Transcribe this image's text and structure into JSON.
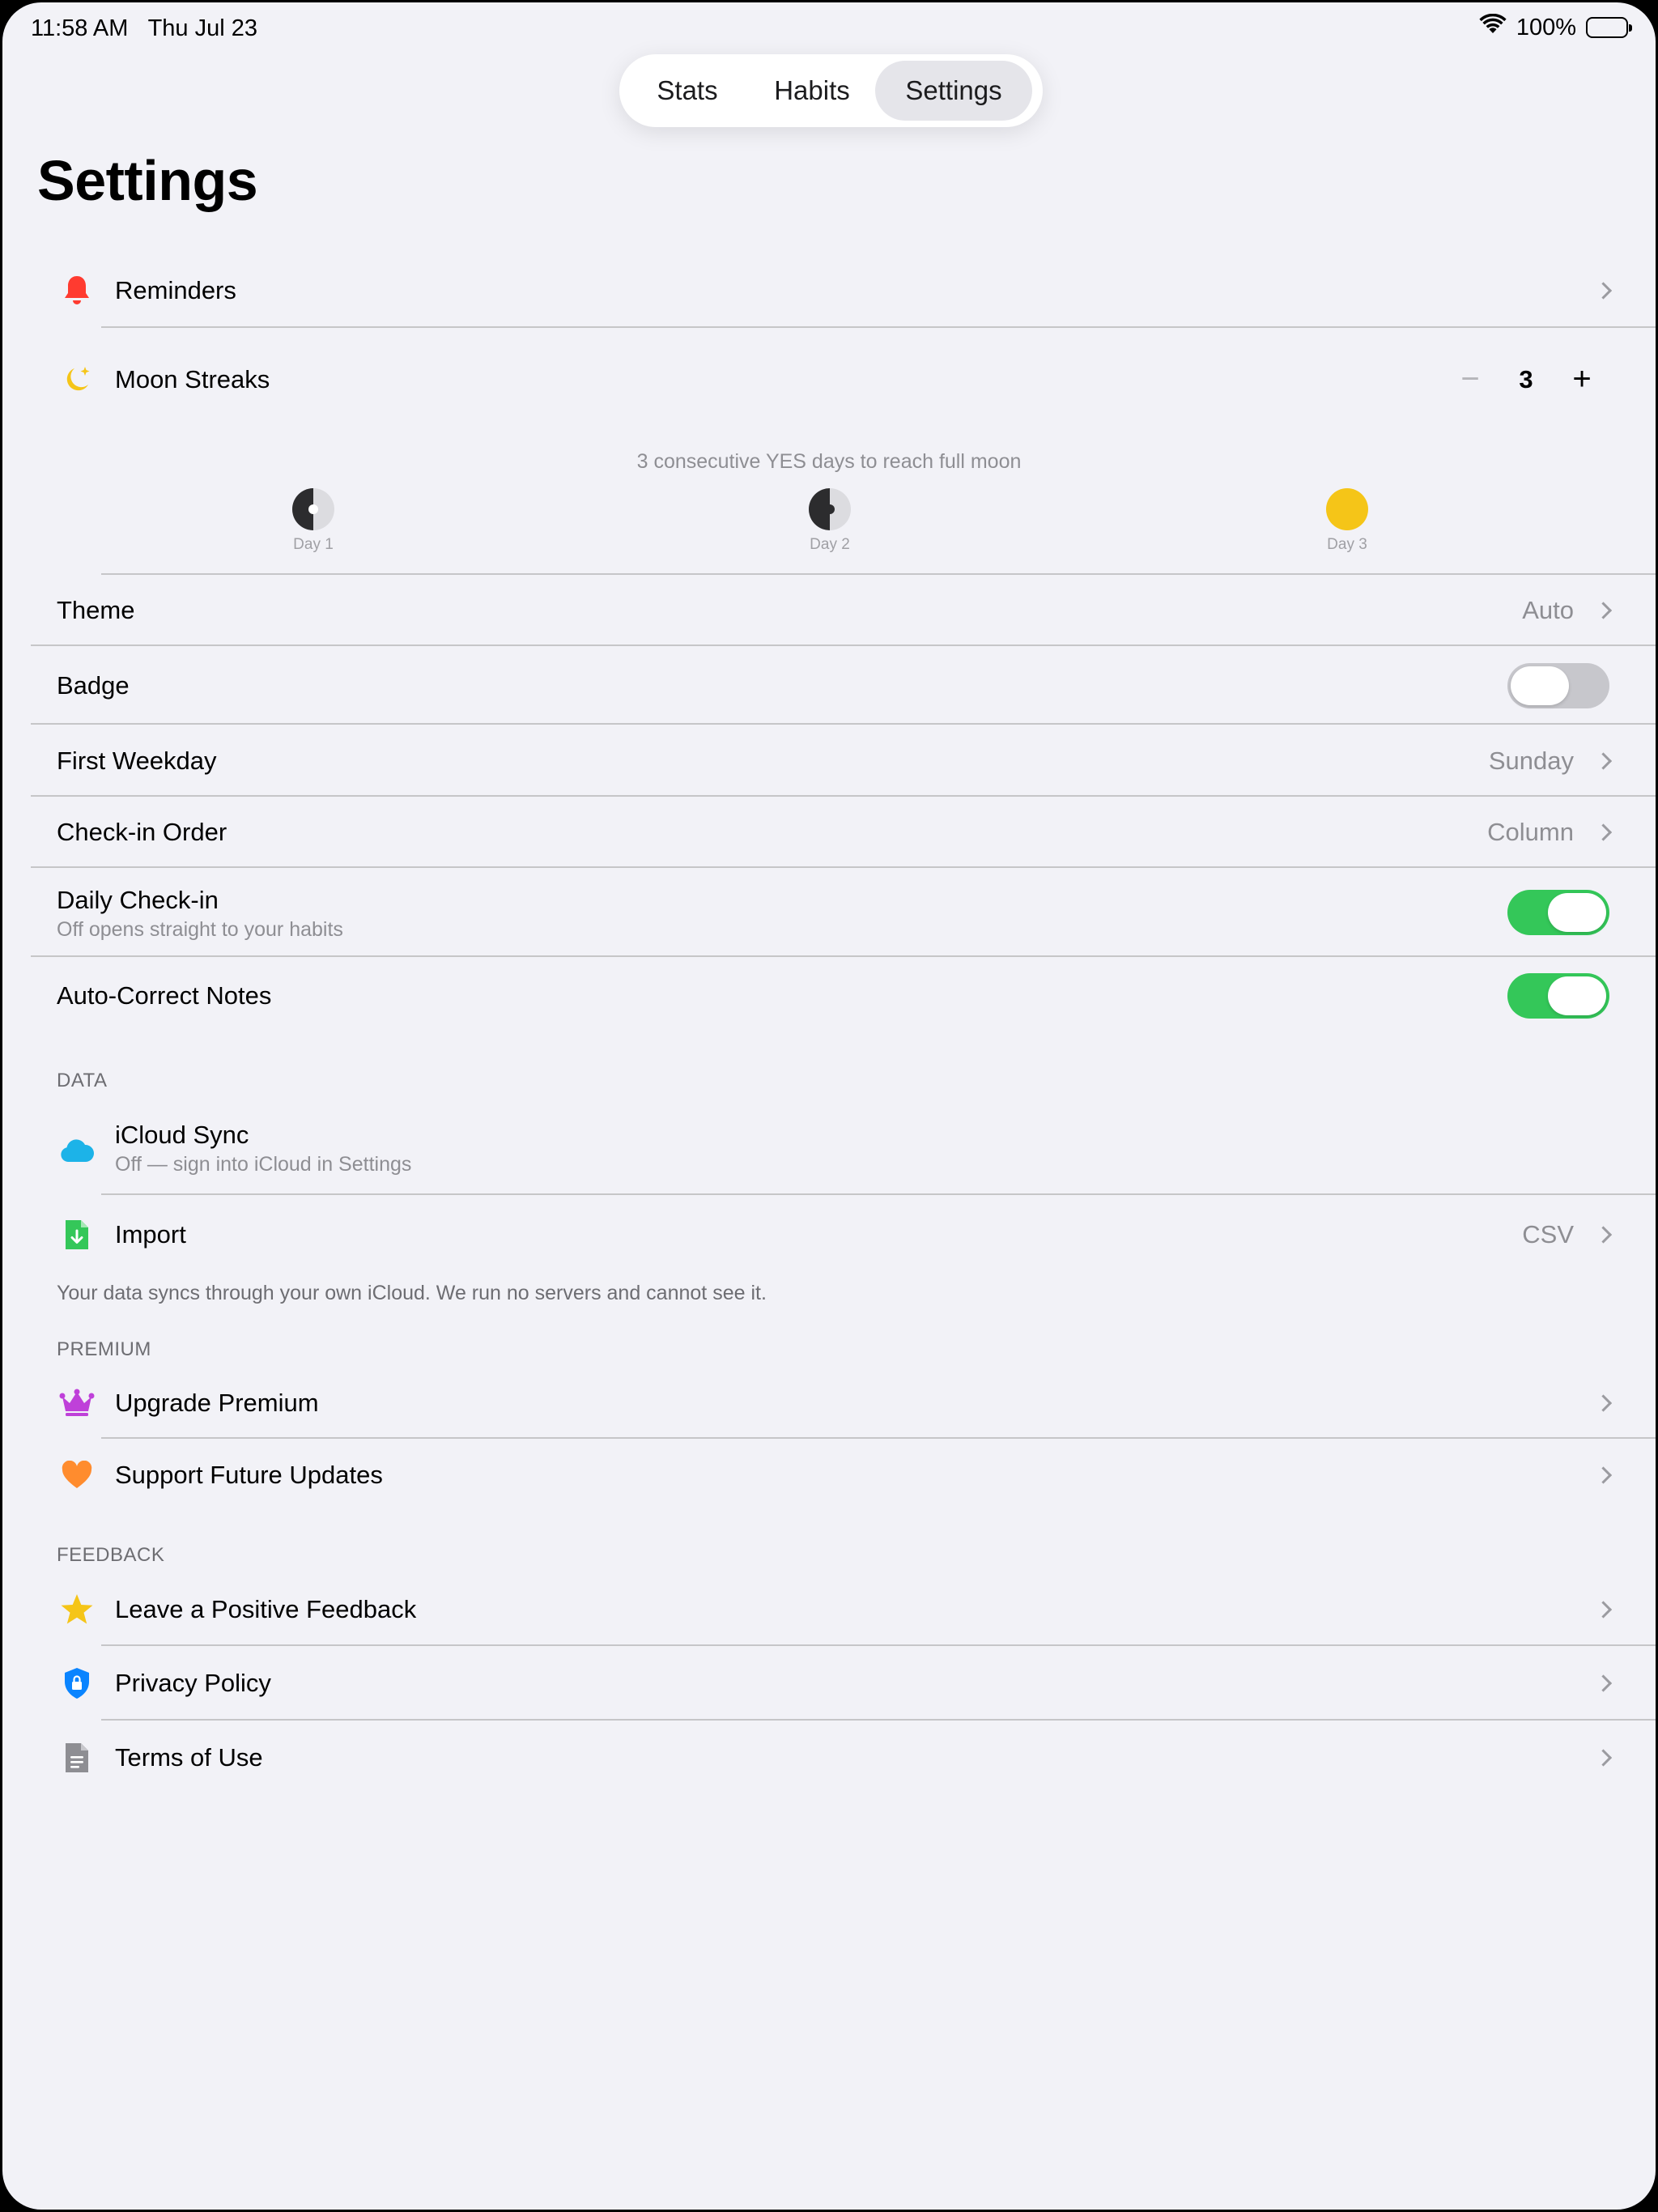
{
  "status": {
    "time": "11:58 AM",
    "date": "Thu Jul 23",
    "battery": "100%"
  },
  "tabs": [
    {
      "label": "Stats"
    },
    {
      "label": "Habits"
    },
    {
      "label": "Settings",
      "selected": true
    }
  ],
  "title": "Settings",
  "main": {
    "reminders": "Reminders",
    "moon_streaks": {
      "label": "Moon Streaks",
      "value": "3",
      "minus": "−",
      "plus": "+"
    },
    "moon_caption": "3 consecutive YES days to reach full moon",
    "moon_days": [
      "Day 1",
      "Day 2",
      "Day 3"
    ],
    "theme": {
      "label": "Theme",
      "value": "Auto"
    },
    "badge": {
      "label": "Badge",
      "on": false
    },
    "first_weekday": {
      "label": "First Weekday",
      "value": "Sunday"
    },
    "checkin_order": {
      "label": "Check-in Order",
      "value": "Column"
    },
    "daily_checkin": {
      "label": "Daily Check-in",
      "subtitle": "Off opens straight to your habits",
      "on": true
    },
    "autocorrect": {
      "label": "Auto-Correct Notes",
      "on": true
    }
  },
  "data_section": {
    "header": "DATA",
    "icloud": {
      "label": "iCloud Sync",
      "subtitle": "Off — sign into iCloud in Settings"
    },
    "import": {
      "label": "Import",
      "value": "CSV"
    },
    "footnote": "Your data syncs through your own iCloud. We run no servers and cannot see it."
  },
  "premium_section": {
    "header": "PREMIUM",
    "upgrade": "Upgrade Premium",
    "support": "Support Future Updates"
  },
  "feedback_section": {
    "header": "FEEDBACK",
    "feedback": "Leave a Positive Feedback",
    "privacy": "Privacy Policy",
    "terms": "Terms of Use"
  },
  "colors": {
    "background": "#f2f2f7",
    "toggle_on": "#34c759",
    "toggle_off": "#c7c7cc",
    "bell": "#ff3b30",
    "moon": "#f5c518",
    "cloud": "#1cb3e8",
    "import": "#34c759",
    "crown": "#bf40d9",
    "heart": "#ff8c2e",
    "star": "#f5c518",
    "shield": "#0a84ff",
    "doc": "#8e8e93"
  }
}
